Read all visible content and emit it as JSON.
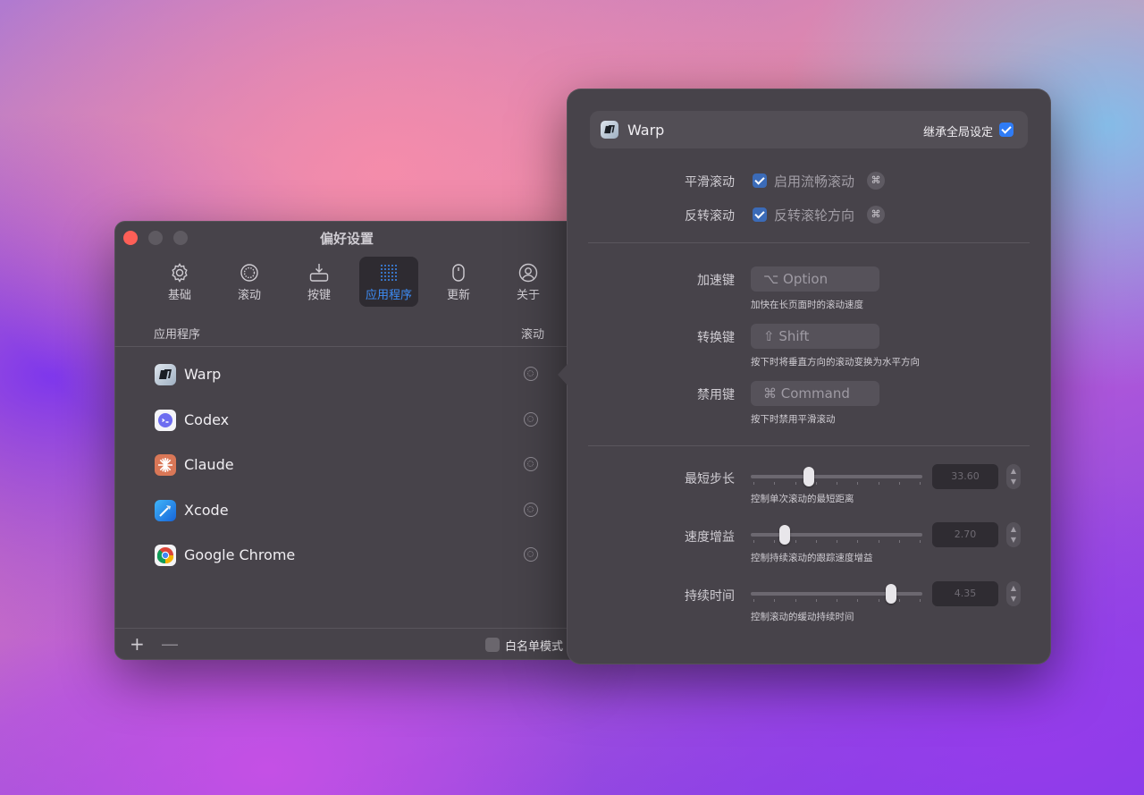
{
  "window": {
    "title": "偏好设置",
    "toolbar": [
      {
        "label": "基础",
        "icon": "gear-icon"
      },
      {
        "label": "滚动",
        "icon": "scroll-icon"
      },
      {
        "label": "按键",
        "icon": "keyboard-icon"
      },
      {
        "label": "应用程序",
        "icon": "apps-grid-icon",
        "active": true
      },
      {
        "label": "更新",
        "icon": "update-icon"
      },
      {
        "label": "关于",
        "icon": "person-icon"
      }
    ],
    "list_header": {
      "app": "应用程序",
      "scroll": "滚动"
    },
    "apps": [
      {
        "name": "Warp",
        "icon": "warp-icon"
      },
      {
        "name": "Codex",
        "icon": "codex-icon"
      },
      {
        "name": "Claude",
        "icon": "claude-icon"
      },
      {
        "name": "Xcode",
        "icon": "xcode-icon"
      },
      {
        "name": "Google Chrome",
        "icon": "chrome-icon"
      }
    ],
    "footer": {
      "add": "+",
      "remove": "—",
      "whitelist_label": "白名单模式",
      "whitelist_checked": false
    }
  },
  "popover": {
    "app_name": "Warp",
    "inherit_label": "继承全局设定",
    "inherit_checked": true,
    "smooth_scroll": {
      "label": "平滑滚动",
      "option": "启用流畅滚动",
      "checked": true
    },
    "reverse_scroll": {
      "label": "反转滚动",
      "option": "反转滚轮方向",
      "checked": true
    },
    "accelerate": {
      "label": "加速键",
      "key": "⌥ Option",
      "hint": "加快在长页面时的滚动速度"
    },
    "convert": {
      "label": "转换键",
      "key": "⇧ Shift",
      "hint": "按下时将垂直方向的滚动变换为水平方向"
    },
    "disable": {
      "label": "禁用键",
      "key": "⌘ Command",
      "hint": "按下时禁用平滑滚动"
    },
    "min_step": {
      "label": "最短步长",
      "value": "33.60",
      "hint": "控制单次滚动的最短距离",
      "fraction": 0.34
    },
    "speed_gain": {
      "label": "速度增益",
      "value": "2.70",
      "hint": "控制持续滚动的跟踪速度增益",
      "fraction": 0.2
    },
    "duration": {
      "label": "持续时间",
      "value": "4.35",
      "hint": "控制滚动的缓动持续时间",
      "fraction": 0.82
    }
  },
  "colors": {
    "accent": "#3d8cf5",
    "close": "#fe5f57",
    "window_bg": "#47434a"
  }
}
